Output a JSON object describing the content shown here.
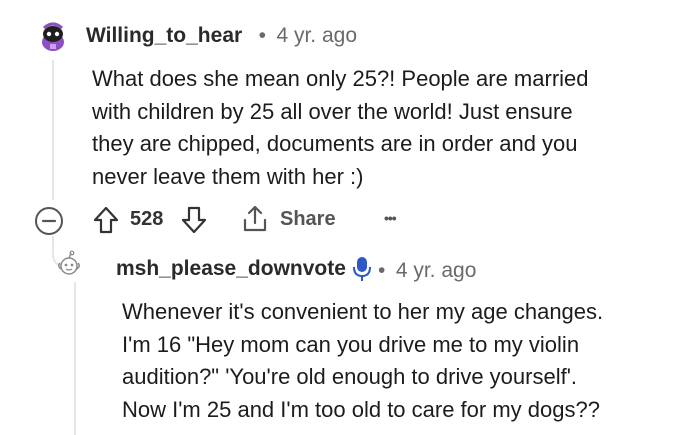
{
  "comment": {
    "username": "Willing_to_hear",
    "separator": "•",
    "age": "4 yr. ago",
    "lines": [
      "What does she mean only 25?! People are married",
      "with children by 25 all over the world! Just ensure",
      "they are chipped, documents are in order and you",
      "never leave them with her :)"
    ],
    "votes": "528",
    "share_label": "Share",
    "more": "•••"
  },
  "reply": {
    "username": "msh_please_downvote",
    "separator": "•",
    "age": "4 yr. ago",
    "lines": [
      "Whenever it's convenient to her my age changes.",
      "I'm 16 \"Hey mom can you drive me to my violin",
      "audition?\" 'You're old enough to drive yourself'.",
      "Now I'm 25 and I'm too old to care for my dogs??"
    ]
  },
  "colors": {
    "text": "#1c1c1c",
    "meta": "#6a6a6a",
    "mic_badge": "#2f58c7",
    "thread_line": "#e6e6e6"
  },
  "icons": [
    "avatar-snoo-purple",
    "collapse-minus-icon",
    "upvote-arrow-icon",
    "downvote-arrow-icon",
    "share-icon",
    "more-options-icon",
    "avatar-snoo-outline",
    "microphone-badge-icon"
  ]
}
